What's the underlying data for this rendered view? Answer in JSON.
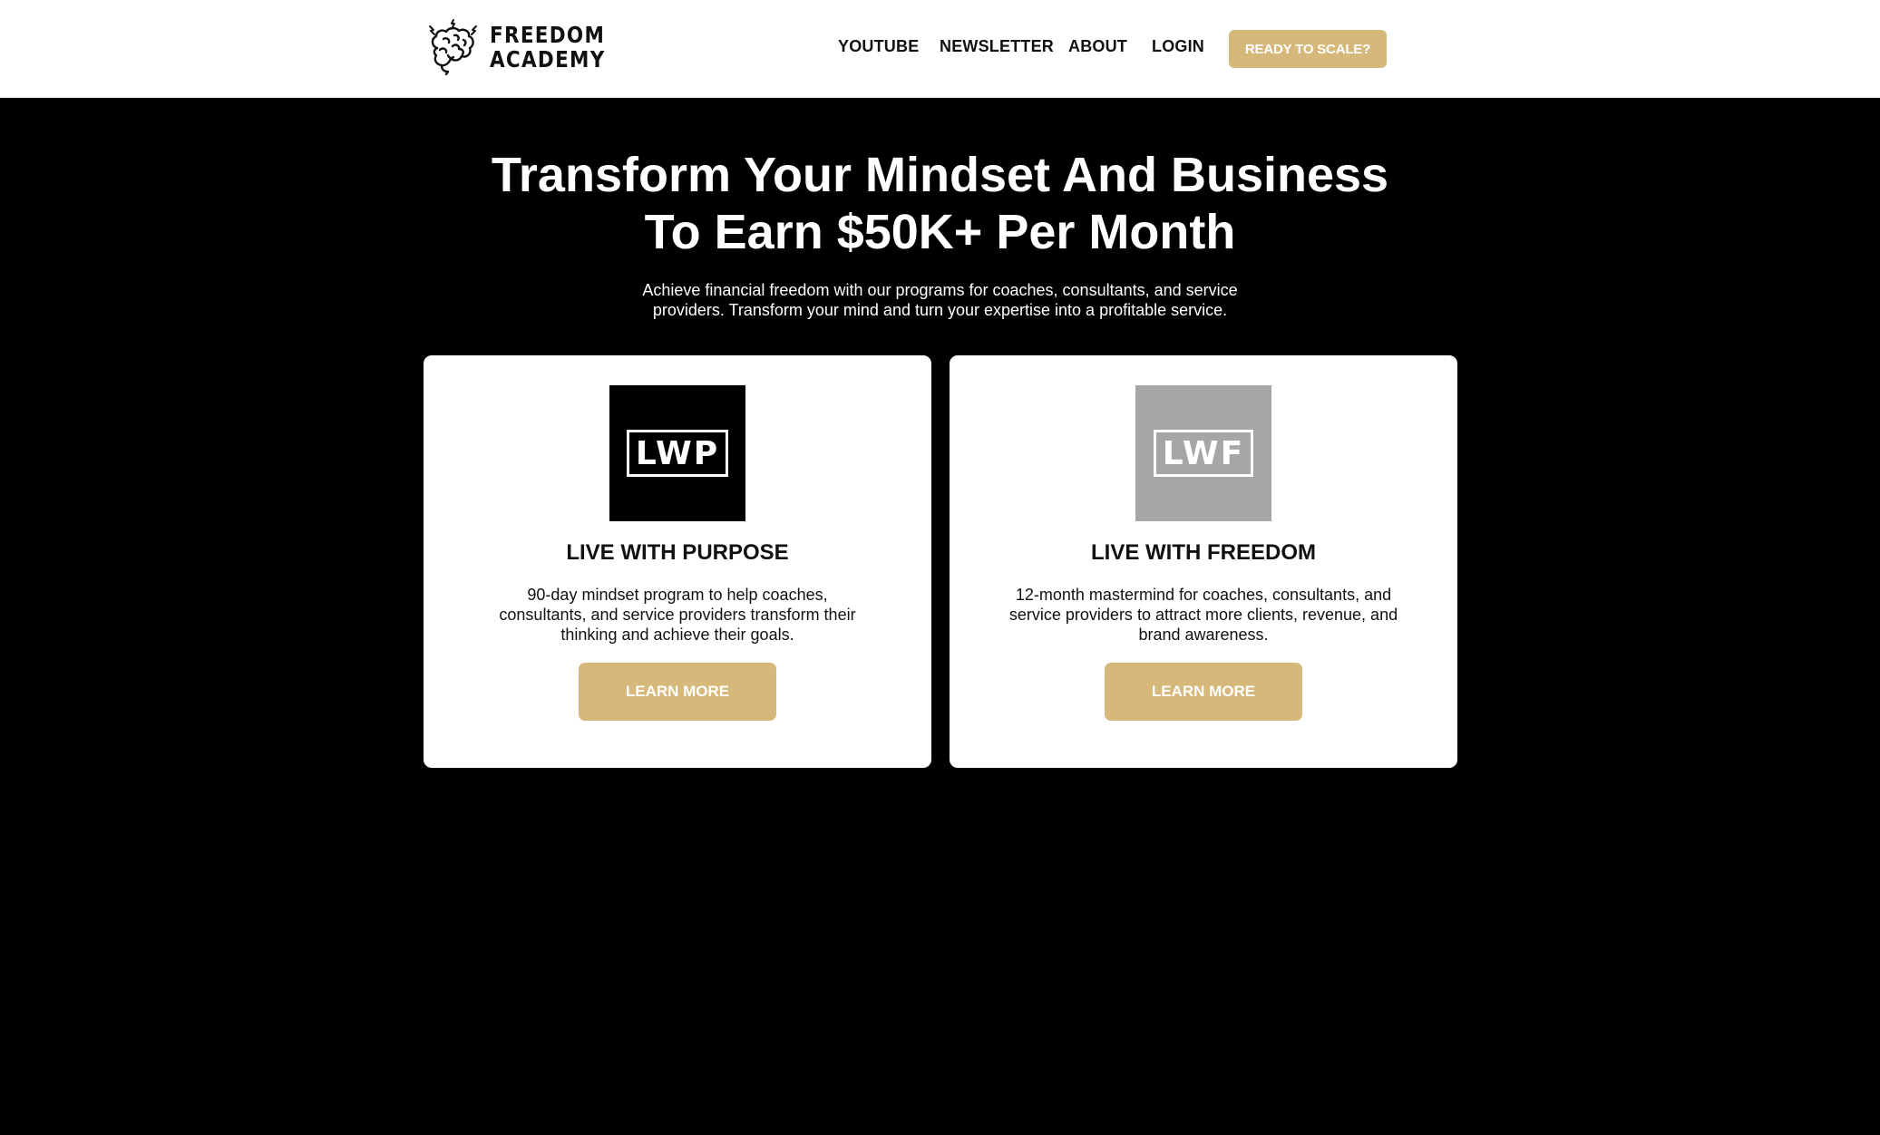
{
  "header": {
    "logo": {
      "line1": "FREEDOM",
      "line2": "ACADEMY",
      "icon": "brain-icon"
    },
    "nav": [
      {
        "label": "YOUTUBE"
      },
      {
        "label": "NEWSLETTER"
      },
      {
        "label": "ABOUT"
      },
      {
        "label": "LOGIN"
      }
    ],
    "cta_label": "READY TO SCALE?"
  },
  "hero": {
    "title_line1": "Transform Your Mindset And Business",
    "title_line2": "To Earn $50K+ Per Month",
    "subtitle_line1": "Achieve financial freedom with our programs for coaches, consultants, and service",
    "subtitle_line2": "providers. Transform your mind and turn your expertise into a profitable service."
  },
  "programs": [
    {
      "logo_text": "LWP",
      "logo_bg": "#000000",
      "title": "LIVE WITH PURPOSE",
      "desc_line1": "90-day mindset program to help coaches,",
      "desc_line2": "consultants, and service providers transform their",
      "desc_line3": "thinking and achieve their goals.",
      "button_label": "LEARN MORE"
    },
    {
      "logo_text": "LWF",
      "logo_bg": "#a6a6a6",
      "title": "LIVE WITH FREEDOM",
      "desc_line1": "12-month mastermind for coaches, consultants, and",
      "desc_line2": "service providers to attract more clients, revenue, and",
      "desc_line3": "brand awareness.",
      "button_label": "LEARN MORE"
    }
  ],
  "colors": {
    "accent": "#d6b97a",
    "background": "#000000",
    "card": "#ffffff"
  }
}
